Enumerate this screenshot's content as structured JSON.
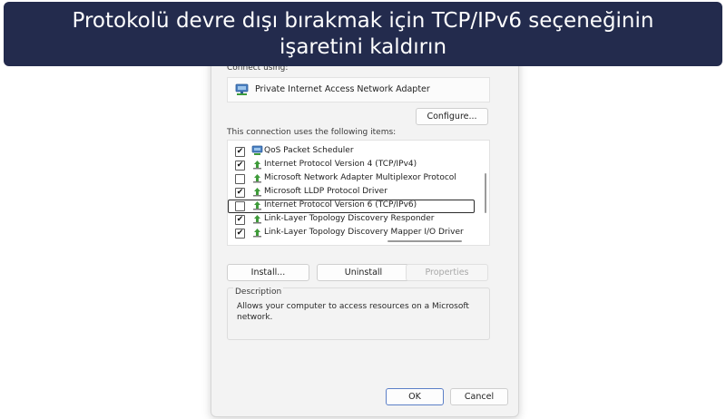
{
  "banner": {
    "text_line1": "Protokolü devre dışı bırakmak için TCP/IPv6 seçeneğinin",
    "text_line2": "işaretini kaldırın"
  },
  "dialog": {
    "connect_using_label": "Connect using:",
    "adapter_name": "Private Internet Access Network Adapter",
    "adapter_icon": "network-adapter-icon",
    "configure_button": "Configure...",
    "items_label": "This connection uses the following items:",
    "items": [
      {
        "label": "QoS Packet Scheduler",
        "checked": "✔",
        "icon": "qos-scheduler-icon"
      },
      {
        "label": "Internet Protocol Version 4 (TCP/IPv4)",
        "checked": "✔",
        "icon": "protocol-icon"
      },
      {
        "label": "Microsoft Network Adapter Multiplexor Protocol",
        "checked": "",
        "icon": "protocol-icon"
      },
      {
        "label": "Microsoft LLDP Protocol Driver",
        "checked": "✔",
        "icon": "protocol-icon"
      },
      {
        "label": "Internet Protocol Version 6 (TCP/IPv6)",
        "checked": "",
        "icon": "protocol-icon"
      },
      {
        "label": "Link-Layer Topology Discovery Responder",
        "checked": "✔",
        "icon": "protocol-icon"
      },
      {
        "label": "Link-Layer Topology Discovery Mapper I/O Driver",
        "checked": "✔",
        "icon": "protocol-icon"
      }
    ],
    "install_button": "Install...",
    "uninstall_button": "Uninstall",
    "properties_button": "Properties",
    "description_title": "Description",
    "description_text": "Allows your computer to access resources on a Microsoft network.",
    "ok_button": "OK",
    "cancel_button": "Cancel"
  },
  "colors": {
    "banner_bg": "#232b4d",
    "protocol_icon_green": "#3f9b3a",
    "highlight_border": "#2b2b2b"
  }
}
